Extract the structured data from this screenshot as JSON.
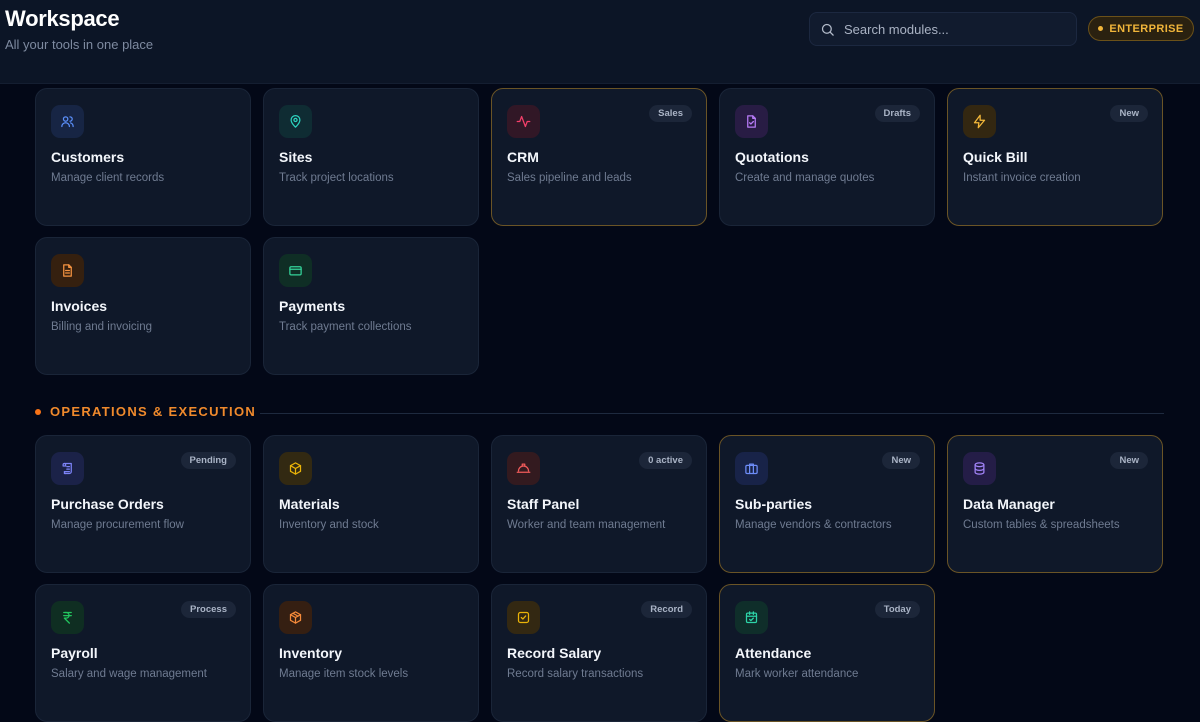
{
  "header": {
    "title": "Workspace",
    "subtitle": "All your tools in one place",
    "search_placeholder": "Search modules...",
    "plan_label": "ENTERPRISE"
  },
  "colors": {
    "accent": "#f97316",
    "plan_gold": "#f0b53a",
    "background": "#030817",
    "card": "#0f1829"
  },
  "sections": [
    {
      "label": "",
      "modules": [
        {
          "title": "Customers",
          "description": "Manage client records",
          "icon": "users-icon",
          "badge": ""
        },
        {
          "title": "Sites",
          "description": "Track project locations",
          "icon": "map-pin-icon",
          "badge": ""
        },
        {
          "title": "CRM",
          "description": "Sales pipeline and leads",
          "icon": "activity-icon",
          "badge": "Sales"
        },
        {
          "title": "Quotations",
          "description": "Create and manage quotes",
          "icon": "file-check-icon",
          "badge": "Drafts"
        },
        {
          "title": "Quick Bill",
          "description": "Instant invoice creation",
          "icon": "lightning-icon",
          "badge": "New"
        },
        {
          "title": "Invoices",
          "description": "Billing and invoicing",
          "icon": "file-text-icon",
          "badge": ""
        },
        {
          "title": "Payments",
          "description": "Track payment collections",
          "icon": "credit-card-icon",
          "badge": ""
        }
      ]
    },
    {
      "label": "OPERATIONS & EXECUTION",
      "modules": [
        {
          "title": "Purchase Orders",
          "description": "Manage procurement flow",
          "icon": "scroll-icon",
          "badge": "Pending"
        },
        {
          "title": "Materials",
          "description": "Inventory and stock",
          "icon": "box-icon",
          "badge": ""
        },
        {
          "title": "Staff Panel",
          "description": "Worker and team management",
          "icon": "hard-hat-icon",
          "badge": "0 active"
        },
        {
          "title": "Sub-parties",
          "description": "Manage vendors & contractors",
          "icon": "briefcase-icon",
          "badge": "New"
        },
        {
          "title": "Data Manager",
          "description": "Custom tables & spreadsheets",
          "icon": "database-icon",
          "badge": "New"
        },
        {
          "title": "Payroll",
          "description": "Salary and wage management",
          "icon": "rupee-icon",
          "badge": "Process"
        },
        {
          "title": "Inventory",
          "description": "Manage item stock levels",
          "icon": "package-icon",
          "badge": ""
        },
        {
          "title": "Record Salary",
          "description": "Record salary transactions",
          "icon": "check-square-icon",
          "badge": "Record"
        },
        {
          "title": "Attendance",
          "description": "Mark worker attendance",
          "icon": "calendar-check-icon",
          "badge": "Today"
        }
      ]
    }
  ]
}
